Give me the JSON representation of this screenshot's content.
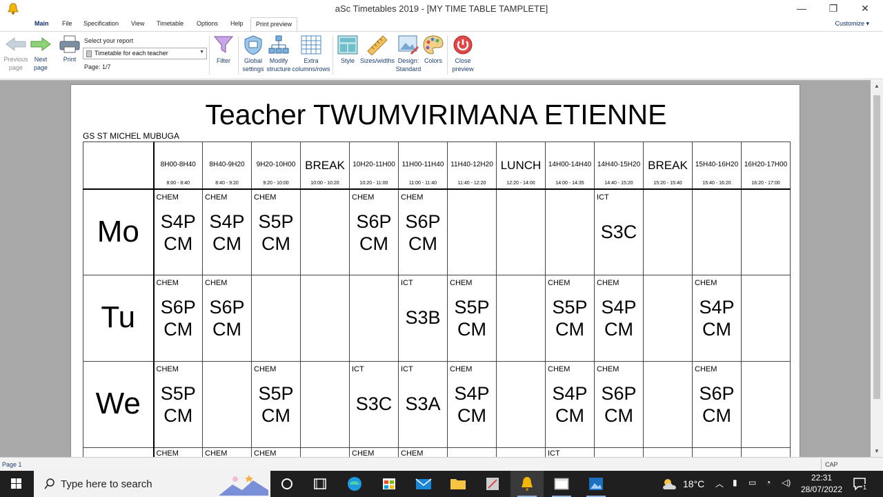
{
  "window": {
    "title": "aSc Timetables 2019  - [MY TIME TABLE TAMPLETE]",
    "minimize": "—",
    "maximize": "❐",
    "close": "✕"
  },
  "tabs": [
    "Main",
    "File",
    "Specification",
    "View",
    "Timetable",
    "Options",
    "Help",
    "Print preview"
  ],
  "customize": "Customize ▾",
  "toolbar": {
    "previous_page": "Previous page",
    "next_page": "Next page",
    "print": "Print",
    "select_report_label": "Select your report",
    "report_selected": "Timetable for each teacher",
    "page_info": "Page: 1/7",
    "filter": "Filter",
    "global_settings": "Global settings",
    "modify_structure": "Modify structure",
    "extra_columns": "Extra columns/rows",
    "style": "Style",
    "sizes_widths": "Sizes/widths",
    "design_standard": "Design: Standard",
    "colors": "Colors",
    "close_preview": "Close preview"
  },
  "document": {
    "title": "Teacher TWUMVIRIMANA  ETIENNE",
    "school": "GS ST MICHEL MUBUGA"
  },
  "timetable": {
    "periods": [
      {
        "label": "8H00-8H40",
        "time": "8:00 - 8:40"
      },
      {
        "label": "8H40-9H20",
        "time": "8:40 - 9:20"
      },
      {
        "label": "9H20-10H00",
        "time": "9:20 - 10:00"
      },
      {
        "label": "BREAK",
        "time": "10:00 - 10:20",
        "big": true
      },
      {
        "label": "10H20-11H00",
        "time": "10:20 - 11:00"
      },
      {
        "label": "11H00-11H40",
        "time": "11:00 - 11:40"
      },
      {
        "label": "11H40-12H20",
        "time": "11:40 - 12:20"
      },
      {
        "label": "LUNCH",
        "time": "12:20 - 14:00",
        "big": true
      },
      {
        "label": "14H00-14H40",
        "time": "14:00 - 14:35"
      },
      {
        "label": "14H40-15H20",
        "time": "14:40 - 15:20"
      },
      {
        "label": "BREAK",
        "time": "15:20 - 15:40",
        "big": true
      },
      {
        "label": "15H40-16H20",
        "time": "15:40 - 16:20"
      },
      {
        "label": "16H20-17H00",
        "time": "16:20 - 17:00"
      }
    ],
    "days": [
      {
        "day": "Mo",
        "cells": [
          {
            "subject": "CHEM",
            "class": "S4P CM"
          },
          {
            "subject": "CHEM",
            "class": "S4P CM"
          },
          {
            "subject": "CHEM",
            "class": "S5P CM"
          },
          null,
          {
            "subject": "CHEM",
            "class": "S6P CM"
          },
          {
            "subject": "CHEM",
            "class": "S6P CM"
          },
          null,
          null,
          null,
          {
            "subject": "ICT",
            "class": "S3C",
            "single": true
          },
          null,
          null,
          null
        ]
      },
      {
        "day": "Tu",
        "cells": [
          {
            "subject": "CHEM",
            "class": "S6P CM"
          },
          {
            "subject": "CHEM",
            "class": "S6P CM"
          },
          null,
          null,
          null,
          {
            "subject": "ICT",
            "class": "S3B",
            "single": true
          },
          {
            "subject": "CHEM",
            "class": "S5P CM"
          },
          null,
          {
            "subject": "CHEM",
            "class": "S5P CM"
          },
          {
            "subject": "CHEM",
            "class": "S4P CM"
          },
          null,
          {
            "subject": "CHEM",
            "class": "S4P CM"
          },
          null
        ]
      },
      {
        "day": "We",
        "cells": [
          {
            "subject": "CHEM",
            "class": "S5P CM"
          },
          null,
          {
            "subject": "CHEM",
            "class": "S5P CM"
          },
          null,
          {
            "subject": "ICT",
            "class": "S3C",
            "single": true
          },
          {
            "subject": "ICT",
            "class": "S3A",
            "single": true
          },
          {
            "subject": "CHEM",
            "class": "S4P CM"
          },
          null,
          {
            "subject": "CHEM",
            "class": "S4P CM"
          },
          {
            "subject": "CHEM",
            "class": "S6P CM"
          },
          null,
          {
            "subject": "CHEM",
            "class": "S6P CM"
          },
          null
        ]
      }
    ],
    "partial_row": [
      "CHEM",
      "CHEM",
      "CHEM",
      "",
      "CHEM",
      "CHEM",
      "",
      "",
      "ICT",
      "",
      "",
      "",
      ""
    ]
  },
  "status": {
    "page": "Page 1",
    "cap": "CAP"
  },
  "taskbar": {
    "search_placeholder": "Type here to search",
    "temperature": "18°C",
    "time": "22:31",
    "date": "28/07/2022",
    "notifications": "1"
  }
}
